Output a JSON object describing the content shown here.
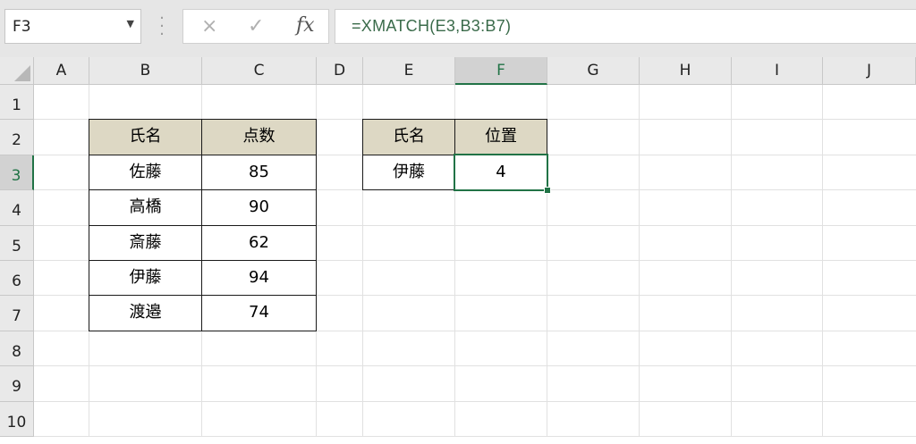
{
  "name_box": {
    "value": "F3"
  },
  "formula_bar": {
    "cancel_icon": "×",
    "enter_icon": "✓",
    "fx_label": "fx",
    "formula": "=XMATCH(E3,B3:B7)"
  },
  "columns": [
    "A",
    "B",
    "C",
    "D",
    "E",
    "F",
    "G",
    "H",
    "I",
    "J"
  ],
  "rows": [
    "1",
    "2",
    "3",
    "4",
    "5",
    "6",
    "7",
    "8",
    "9",
    "10"
  ],
  "selected_cell": {
    "column": "F",
    "row": "3"
  },
  "table1": {
    "headers": [
      "氏名",
      "点数"
    ],
    "rows": [
      [
        "佐藤",
        "85"
      ],
      [
        "高橋",
        "90"
      ],
      [
        "斎藤",
        "62"
      ],
      [
        "伊藤",
        "94"
      ],
      [
        "渡邉",
        "74"
      ]
    ]
  },
  "table2": {
    "headers": [
      "氏名",
      "位置"
    ],
    "rows": [
      [
        "伊藤",
        "4"
      ]
    ]
  },
  "colors": {
    "header_fill": "#ddd8c4",
    "selection": "#217346"
  }
}
